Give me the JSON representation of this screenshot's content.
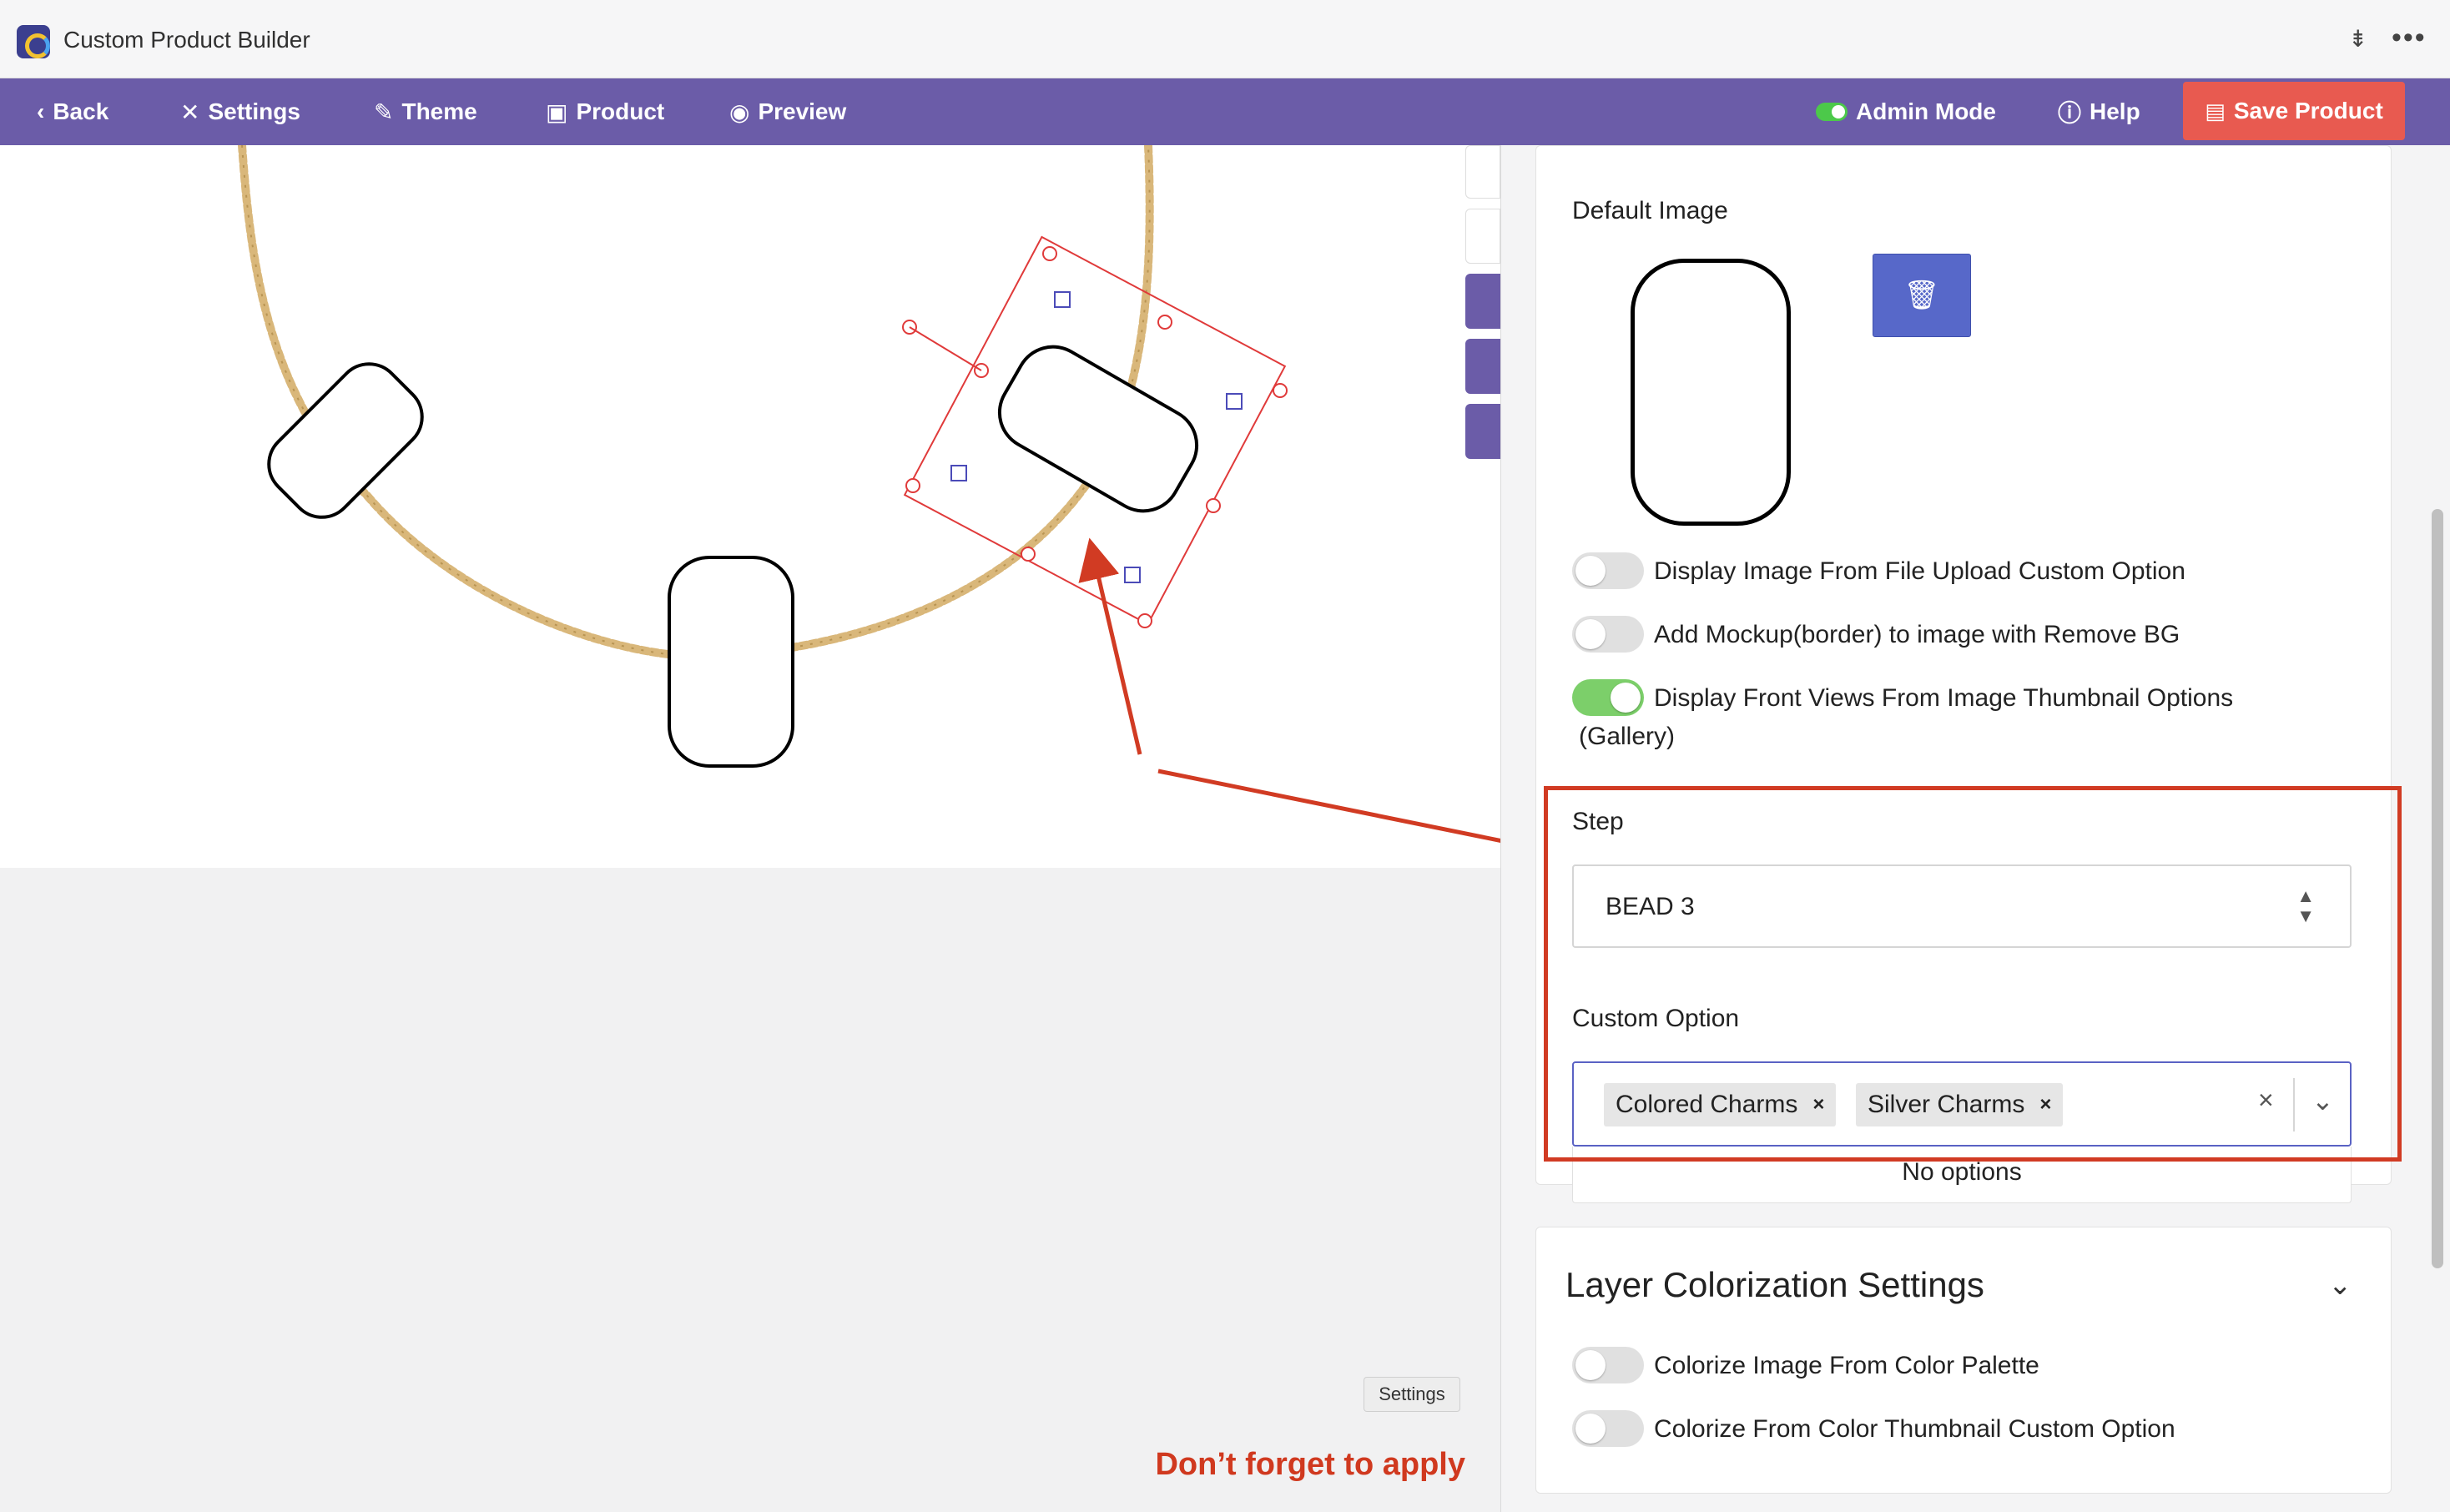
{
  "window": {
    "title": "Custom Product Builder"
  },
  "toolbar": {
    "back": "Back",
    "settings": "Settings",
    "theme": "Theme",
    "product": "Product",
    "preview": "Preview",
    "admin_mode": "Admin Mode",
    "help": "Help",
    "save_product": "Save Product"
  },
  "canvas": {
    "settings_chip": "Settings",
    "reminder": "Don’t forget to apply"
  },
  "panel": {
    "default_image_label": "Default Image",
    "options": [
      {
        "label": "Display Image From File Upload Custom Option",
        "enabled": false
      },
      {
        "label": "Add Mockup(border) to image with Remove BG",
        "enabled": false
      },
      {
        "label": "Display Front Views From Image Thumbnail Options",
        "label_cont": "(Gallery)",
        "enabled": true
      }
    ],
    "step": {
      "label": "Step",
      "value": "BEAD 3"
    },
    "custom_option": {
      "label": "Custom Option",
      "selected": [
        "Colored Charms",
        "Silver Charms"
      ],
      "menu_text": "No options"
    },
    "layer_colorization": {
      "title": "Layer Colorization Settings",
      "options": [
        {
          "label": "Colorize Image From Color Palette",
          "enabled": false
        },
        {
          "label": "Colorize From Color Thumbnail Custom Option",
          "enabled": false
        }
      ]
    }
  },
  "colors": {
    "toolbar": "#6b5ca8",
    "save_button": "#e85a50",
    "annotation": "#d13b23",
    "toggle_on": "#7ccf6a",
    "delete_button": "#5768c9",
    "chain": "#d9b77a"
  },
  "icons": [
    "app-logo-icon",
    "pin-icon",
    "more-icon",
    "back-chevron-icon",
    "tools-icon",
    "brush-icon",
    "bag-icon",
    "eye-icon",
    "toggle-icon",
    "help-icon",
    "save-icon",
    "trash-icon",
    "sort-arrows-icon",
    "clear-icon",
    "chevron-down-icon"
  ]
}
